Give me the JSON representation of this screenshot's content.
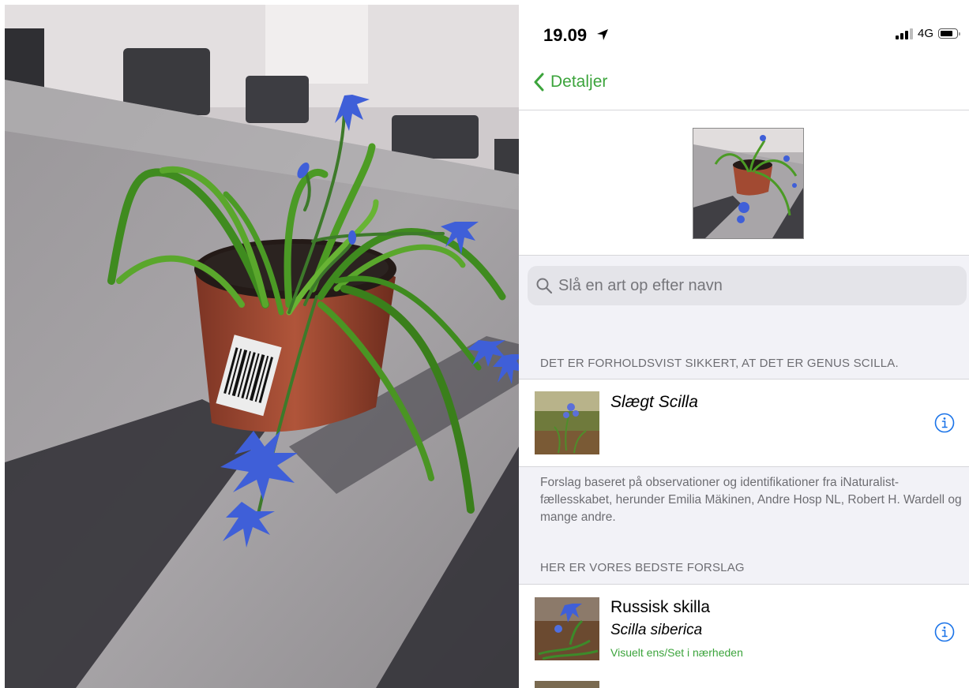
{
  "status_bar": {
    "time": "19.09",
    "network": "4G"
  },
  "nav": {
    "back_label": "Detaljer"
  },
  "search": {
    "placeholder": "Slå en art op efter navn"
  },
  "confidence_header": "DET ER FORHOLDSVIST SIKKERT, AT DET ER GENUS SCILLA.",
  "top_result": {
    "name": "Slægt Scilla"
  },
  "footnote": "Forslag baseret på observationer og identifikationer fra iNaturalist-fællesskabet, herunder Emilia Mäkinen, Andre Hosp NL, Robert H. Wardell og mange andre.",
  "suggestions_header": "HER ER VORES BEDSTE FORSLAG",
  "suggestions": [
    {
      "common_name": "Russisk skilla",
      "scientific_name": "Scilla siberica",
      "match": "Visuelt ens/Set i nærheden"
    }
  ],
  "colors": {
    "accent": "#3ca43c",
    "info": "#1a73e8",
    "flower": "#3f5fd8",
    "pot": "#a24a32"
  },
  "icons": {
    "back": "chevron-left-icon",
    "search": "magnifier-icon",
    "info": "info-circle-icon",
    "location": "location-arrow-icon"
  }
}
